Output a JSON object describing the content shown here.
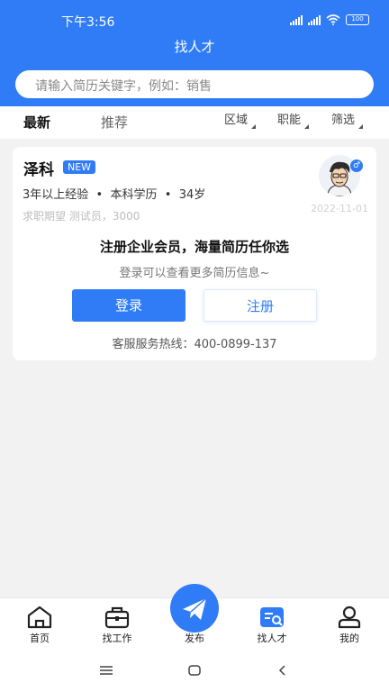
{
  "status_bar": {
    "time": "下午3:56",
    "battery": "100"
  },
  "header": {
    "title": "找人才"
  },
  "search": {
    "placeholder": "请输入简历关键字，例如：销售"
  },
  "tabs": [
    {
      "label": "最新"
    },
    {
      "label": "推荐"
    }
  ],
  "filters": [
    {
      "label": "区域"
    },
    {
      "label": "职能"
    },
    {
      "label": "筛选"
    }
  ],
  "candidate": {
    "name": "泽科",
    "badge": "NEW",
    "experience": "3年以上经验",
    "education": "本科学历",
    "age": "34岁",
    "expectation": "求职期望 测试员，3000",
    "date": "2022-11-01",
    "gender_symbol": "♂"
  },
  "login_prompt": {
    "title": "注册企业会员，海量简历任你选",
    "subtitle": "登录可以查看更多简历信息~",
    "login_label": "登录",
    "register_label": "注册",
    "hotline": "客服服务热线：400-0899-137"
  },
  "tabbar": [
    {
      "label": "首页",
      "icon": "home-icon"
    },
    {
      "label": "找工作",
      "icon": "briefcase-icon"
    },
    {
      "label": "发布",
      "icon": "paper-plane-icon"
    },
    {
      "label": "找人才",
      "icon": "talent-search-icon"
    },
    {
      "label": "我的",
      "icon": "user-icon"
    }
  ],
  "colors": {
    "accent": "#2f7cf6",
    "background": "#f2f2f2"
  }
}
